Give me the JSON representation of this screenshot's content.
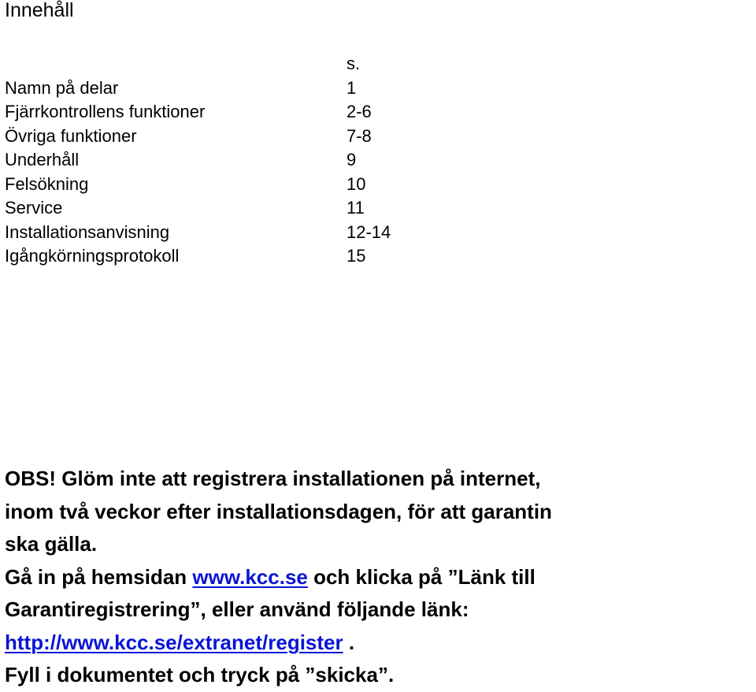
{
  "title": "Innehåll",
  "toc": {
    "page_header": "s.",
    "items": [
      {
        "label": "Namn på delar",
        "page": "1"
      },
      {
        "label": "Fjärrkontrollens funktioner",
        "page": "2-6"
      },
      {
        "label": "Övriga funktioner",
        "page": "7-8"
      },
      {
        "label": "Underhåll",
        "page": "9"
      },
      {
        "label": "Felsökning",
        "page": "10"
      },
      {
        "label": "Service",
        "page": "11"
      },
      {
        "label": "Installationsanvisning",
        "page": "12-14"
      },
      {
        "label": "Igångkörningsprotokoll",
        "page": "15"
      }
    ]
  },
  "notice": {
    "line1": "OBS! Glöm inte att registrera installationen på internet,",
    "line2": "inom två veckor efter installationsdagen, för att garantin",
    "line3": "ska gälla.",
    "line4_prefix": "Gå in på hemsidan ",
    "site_link": "www.kcc.se",
    "line4_suffix": " och klicka på ”Länk till",
    "line5": "Garantiregistrering”, eller använd följande länk:",
    "register_link": "http://www.kcc.se/extranet/register",
    "line6_suffix": " .",
    "line7": "Fyll i dokumentet och tryck på ”skicka”."
  },
  "colors": {
    "text": "#000000",
    "link": "#0a14d6",
    "background": "#ffffff"
  }
}
